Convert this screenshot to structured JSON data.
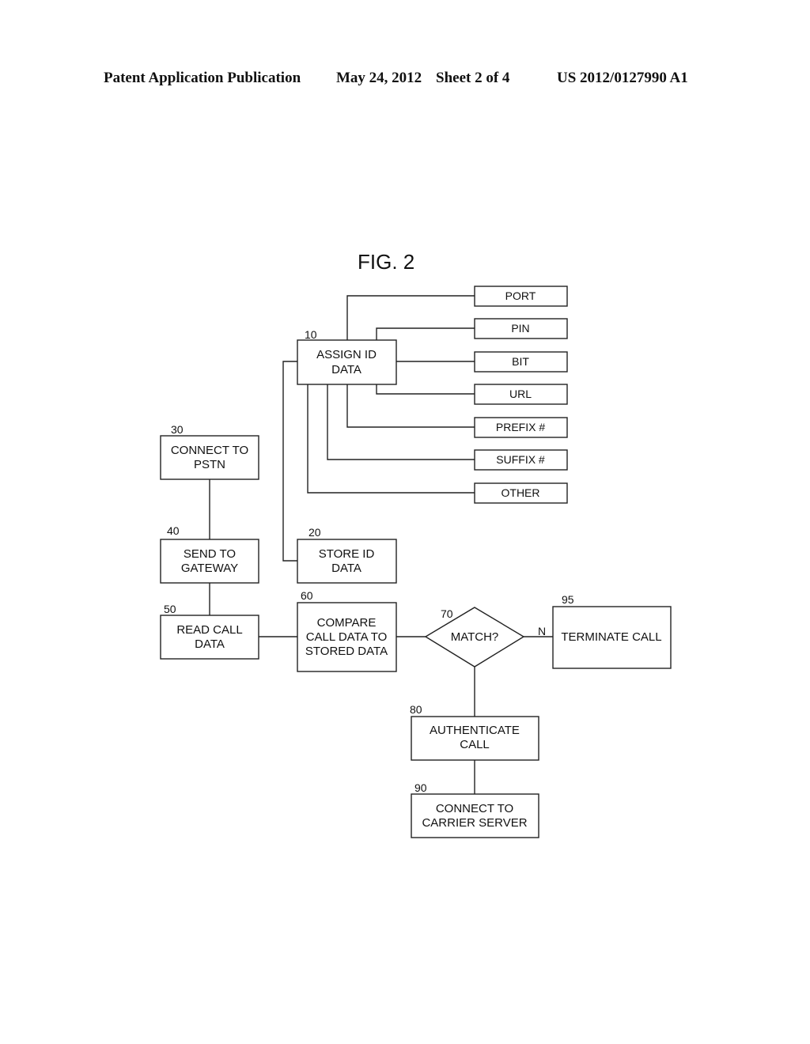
{
  "header": {
    "publication": "Patent Application Publication",
    "date": "May 24, 2012",
    "sheet": "Sheet 2 of 4",
    "number": "US 2012/0127990 A1"
  },
  "figure": {
    "title": "FIG. 2",
    "nodes": {
      "n10": {
        "ref": "10",
        "line1": "ASSIGN ID",
        "line2": "DATA"
      },
      "n20": {
        "ref": "20",
        "line1": "STORE ID",
        "line2": "DATA"
      },
      "n30": {
        "ref": "30",
        "line1": "CONNECT TO",
        "line2": "PSTN"
      },
      "n40": {
        "ref": "40",
        "line1": "SEND TO",
        "line2": "GATEWAY"
      },
      "n50": {
        "ref": "50",
        "line1": "READ CALL",
        "line2": "DATA"
      },
      "n60": {
        "ref": "60",
        "line1": "COMPARE",
        "line2": "CALL DATA TO",
        "line3": "STORED DATA"
      },
      "n70": {
        "ref": "70",
        "label": "MATCH?",
        "no_label": "N"
      },
      "n80": {
        "ref": "80",
        "line1": "AUTHENTICATE",
        "line2": "CALL"
      },
      "n90": {
        "ref": "90",
        "line1": "CONNECT TO",
        "line2": "CARRIER SERVER"
      },
      "n95": {
        "ref": "95",
        "line1": "TERMINATE CALL"
      }
    },
    "id_types": [
      "PORT",
      "PIN",
      "BIT",
      "URL",
      "PREFIX #",
      "SUFFIX #",
      "OTHER"
    ]
  }
}
